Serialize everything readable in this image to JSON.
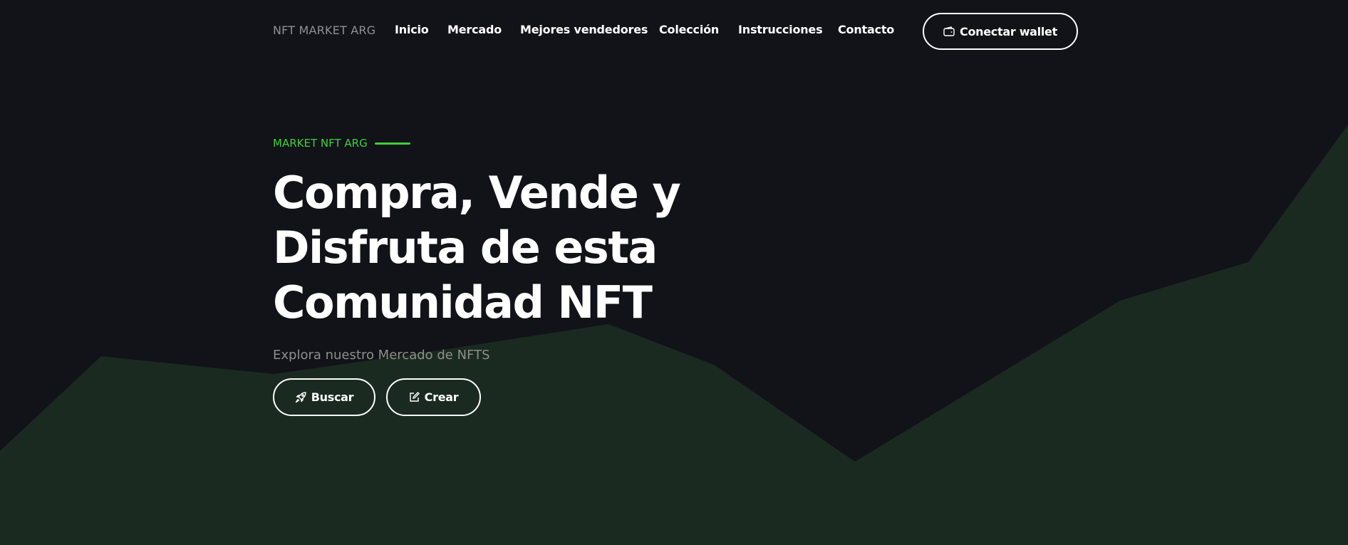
{
  "header": {
    "brand": "NFT MARKET ARG",
    "nav": [
      {
        "label": "Inicio"
      },
      {
        "label": "Mercado"
      },
      {
        "label": "Mejores vendedores"
      },
      {
        "label": "Colección"
      },
      {
        "label": "Instrucciones"
      },
      {
        "label": "Contacto"
      }
    ],
    "wallet_button": {
      "label": "Conectar wallet",
      "icon": "wallet-icon"
    }
  },
  "hero": {
    "eyebrow": "MARKET NFT ARG",
    "title_lines": [
      "Compra, Vende y",
      "Disfruta de esta",
      "Comunidad NFT"
    ],
    "subtitle": "Explora nuestro Mercado de NFTS",
    "buttons": [
      {
        "label": "Buscar",
        "icon": "rocket-icon"
      },
      {
        "label": "Crear",
        "icon": "edit-icon"
      }
    ]
  },
  "colors": {
    "background": "#121219",
    "accent": "#3ed03b",
    "mountain": "#1a2a20",
    "text": "#ffffff",
    "muted": "#8f9096"
  }
}
